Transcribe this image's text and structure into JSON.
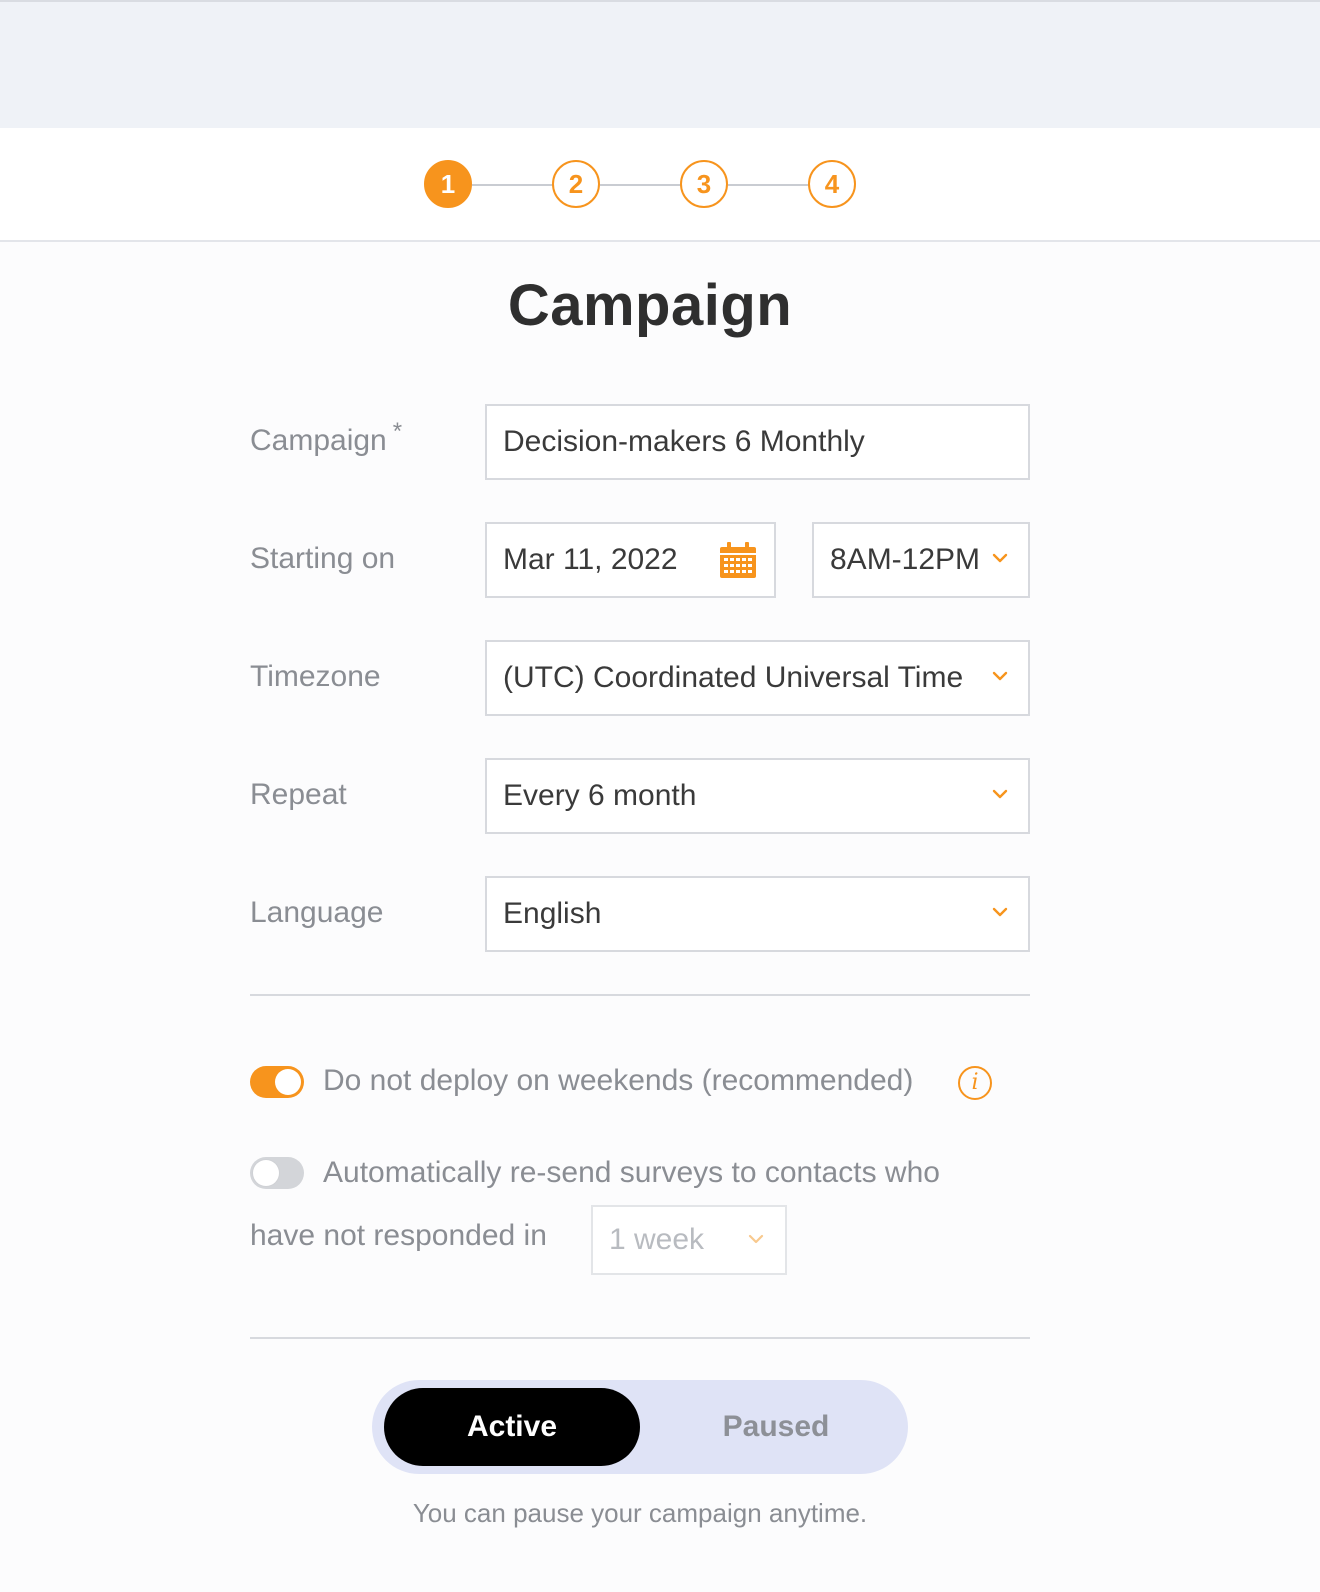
{
  "steps": [
    "1",
    "2",
    "3",
    "4"
  ],
  "title": "Campaign",
  "form": {
    "campaign_label": "Campaign",
    "required_mark": "*",
    "campaign_value": "Decision-makers 6 Monthly",
    "starting_label": "Starting on",
    "date_value": "Mar 11, 2022",
    "time_value": "8AM-12PM",
    "timezone_label": "Timezone",
    "timezone_value": "(UTC) Coordinated Universal Time",
    "repeat_label": "Repeat",
    "repeat_value": "Every 6 month",
    "language_label": "Language",
    "language_value": "English"
  },
  "options": {
    "weekends_text": "Do not deploy on weekends (recommended)",
    "weekends_on": true,
    "resend_text_line1": "Automatically re-send surveys to contacts who",
    "resend_text_line2": "have not responded in",
    "resend_on": false,
    "resend_interval": "1 week"
  },
  "status": {
    "active_label": "Active",
    "paused_label": "Paused",
    "selected": "Active",
    "note": "You can pause your campaign anytime."
  },
  "colors": {
    "accent": "#f7941d",
    "active_segment": "#000000",
    "segment_track": "#dfe3f6",
    "top_band": "#eff2f7"
  },
  "icons": {
    "calendar": "calendar-icon",
    "dropdown": "chevron-down-icon",
    "info": "info-icon"
  }
}
